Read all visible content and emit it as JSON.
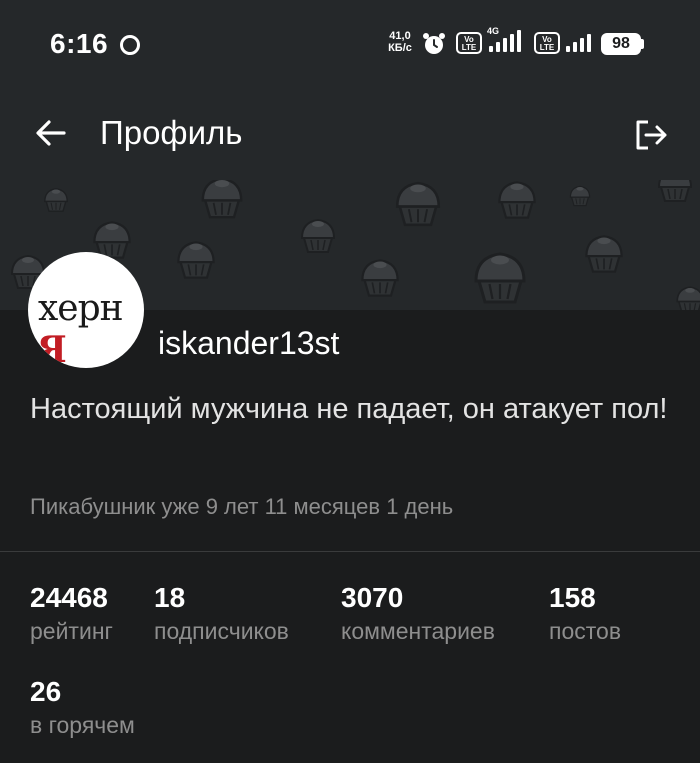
{
  "status_bar": {
    "time": "6:16",
    "net_speed_value": "41,0",
    "net_speed_unit": "КБ/с",
    "volte_label_line1": "Vo",
    "volte_label_line2": "LTE",
    "network_type": "4G",
    "battery": "98"
  },
  "app_bar": {
    "title": "Профиль"
  },
  "profile": {
    "avatar_text_main": "херн",
    "avatar_text_red": "R",
    "username": "iskander13st",
    "bio": "Настоящий мужчина не падает, он атакует пол!",
    "member_since": "Пикабушник уже 9 лет 11 месяцев 1 день"
  },
  "stats": [
    {
      "value": "24468",
      "label": "рейтинг"
    },
    {
      "value": "18",
      "label": "подписчиков"
    },
    {
      "value": "3070",
      "label": "комментариев"
    },
    {
      "value": "158",
      "label": "постов"
    },
    {
      "value": "26",
      "label": "в горячем"
    }
  ],
  "colors": {
    "background": "#1b1c1d",
    "header": "#25282a",
    "secondary_text": "#8e8e8e",
    "avatar_accent": "#c21d24"
  }
}
